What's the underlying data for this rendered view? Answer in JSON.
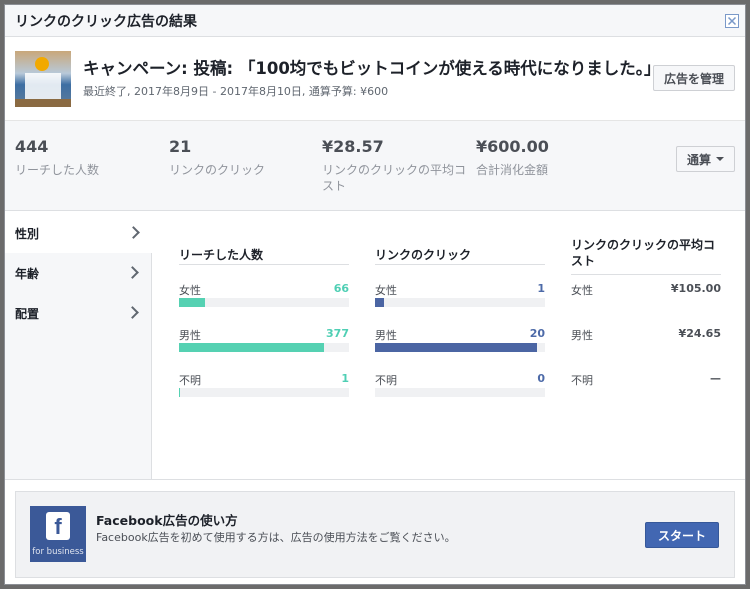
{
  "dialog": {
    "title": "リンクのクリック広告の結果"
  },
  "campaign": {
    "title": "キャンペーン: 投稿: 「100均でもビットコインが使える時代になりました。」",
    "subtitle": "最近終了, 2017年8月9日 - 2017年8月10日, 通算予算: ¥600",
    "manage_label": "広告を管理"
  },
  "stats": [
    {
      "value": "444",
      "label": "リーチした人数"
    },
    {
      "value": "21",
      "label": "リンクのクリック"
    },
    {
      "value": "¥28.57",
      "label": "リンクのクリックの平均コスト"
    },
    {
      "value": "¥600.00",
      "label": "合計消化金額"
    }
  ],
  "scope_button": "通算",
  "sidebar": {
    "items": [
      {
        "label": "性別"
      },
      {
        "label": "年齢"
      },
      {
        "label": "配置"
      }
    ]
  },
  "breakdown": {
    "reach": {
      "header": "リーチした人数",
      "rows": [
        {
          "label": "女性",
          "value": "66",
          "fraction": 0.15
        },
        {
          "label": "男性",
          "value": "377",
          "fraction": 0.85
        },
        {
          "label": "不明",
          "value": "1",
          "fraction": 0.01
        }
      ]
    },
    "clicks": {
      "header": "リンクのクリック",
      "rows": [
        {
          "label": "女性",
          "value": "1",
          "fraction": 0.05
        },
        {
          "label": "男性",
          "value": "20",
          "fraction": 0.95
        },
        {
          "label": "不明",
          "value": "0",
          "fraction": 0
        }
      ]
    },
    "cpc": {
      "header": "リンクのクリックの平均コスト",
      "rows": [
        {
          "label": "女性",
          "value": "¥105.00"
        },
        {
          "label": "男性",
          "value": "¥24.65"
        },
        {
          "label": "不明",
          "value": "—"
        }
      ]
    }
  },
  "footer": {
    "logo_text": "f",
    "logo_sub": "for business",
    "title": "Facebook広告の使い方",
    "description": "Facebook広告を初めて使用する方は、広告の使用方法をご覧ください。",
    "start_label": "スタート"
  },
  "colors": {
    "reach": "#55d1b2",
    "clicks": "#4b65a3",
    "primary": "#4267b2"
  }
}
